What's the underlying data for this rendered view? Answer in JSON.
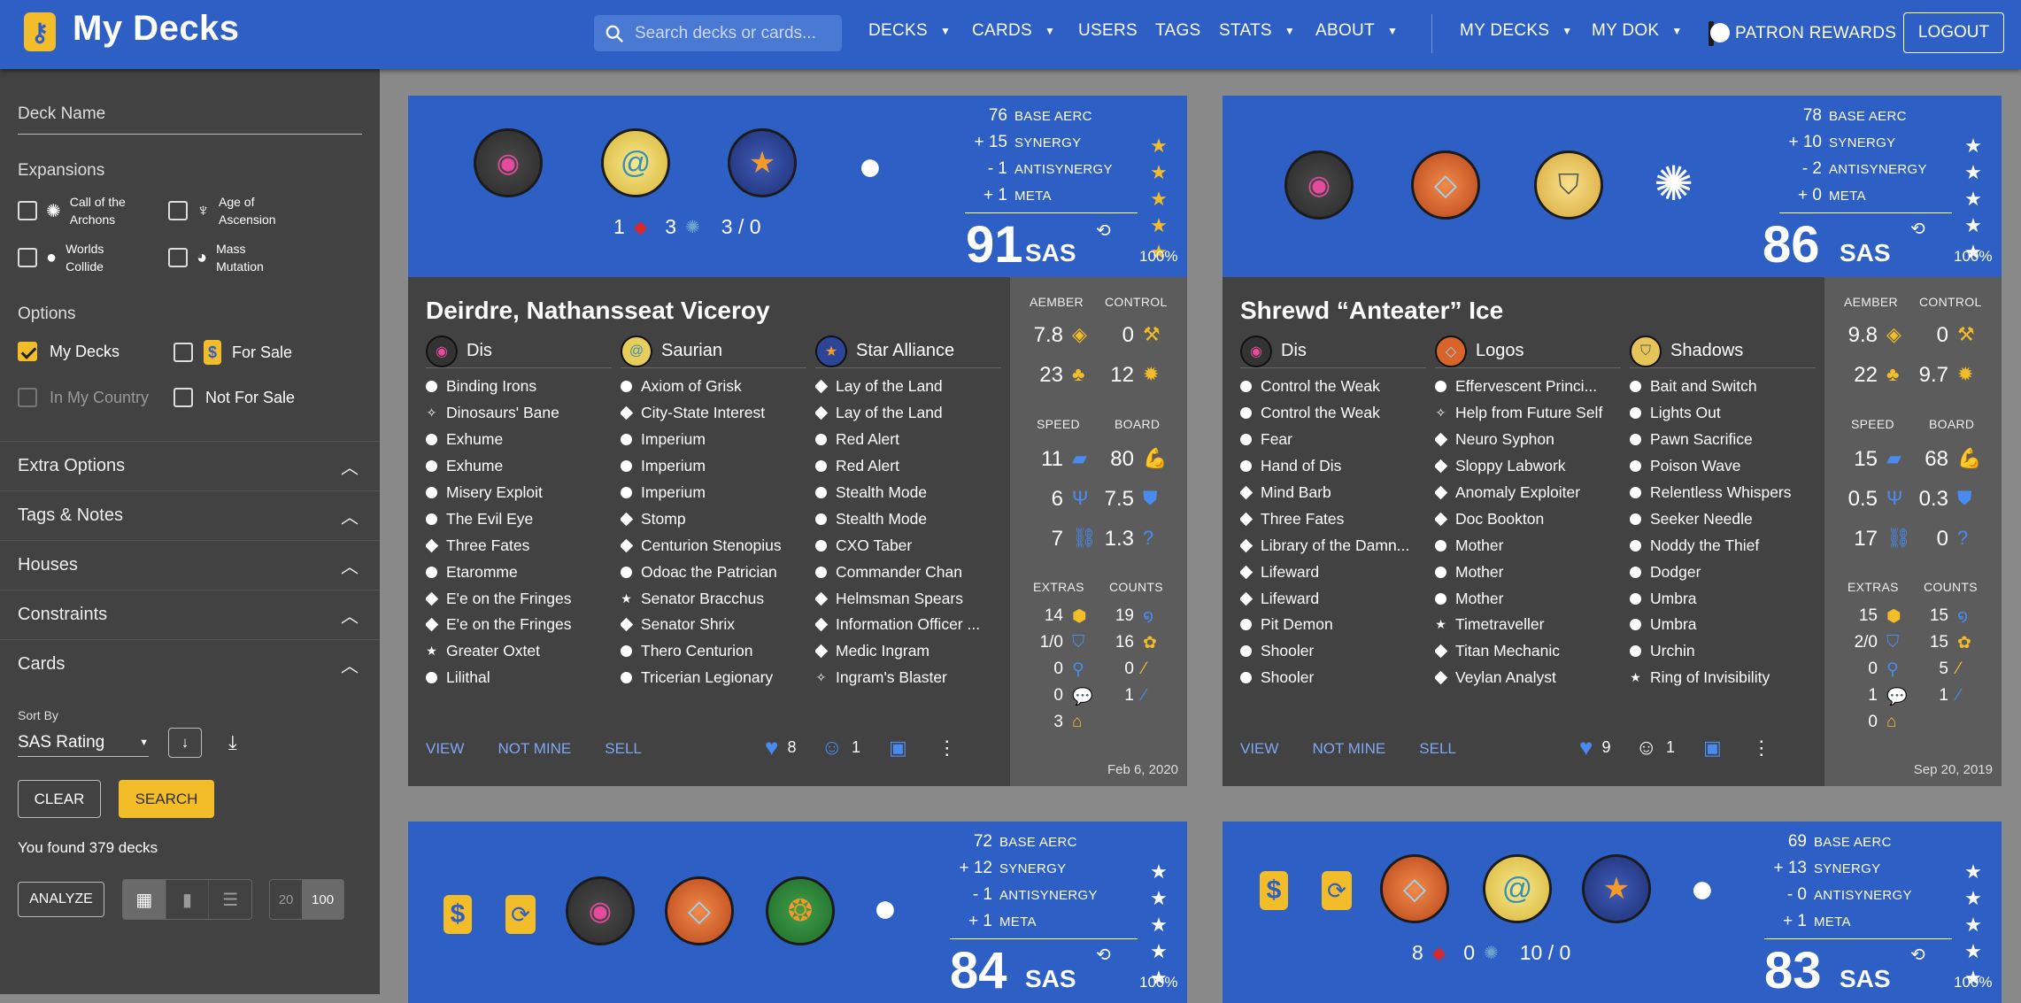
{
  "header": {
    "brand": "My Decks",
    "search_placeholder": "Search decks or cards...",
    "nav": [
      "DECKS",
      "CARDS",
      "USERS",
      "TAGS",
      "STATS",
      "ABOUT"
    ],
    "nav_right": [
      "MY DECKS",
      "MY DOK"
    ],
    "patron": "PATRON REWARDS",
    "logout": "LOGOUT"
  },
  "sidebar": {
    "deck_name_placeholder": "Deck Name",
    "expansions_title": "Expansions",
    "expansions": [
      "Call of the Archons",
      "Age of Ascension",
      "Worlds Collide",
      "Mass Mutation"
    ],
    "options_title": "Options",
    "options": {
      "my_decks": "My Decks",
      "for_sale": "For Sale",
      "in_my_country": "In My Country",
      "not_for_sale": "Not For Sale"
    },
    "sections": [
      "Extra Options",
      "Tags & Notes",
      "Houses",
      "Constraints",
      "Cards"
    ],
    "sort_by_label": "Sort By",
    "sort_value": "SAS Rating",
    "clear": "CLEAR",
    "search": "SEARCH",
    "found": "You found 379 decks",
    "analyze": "ANALYZE",
    "page_sizes": [
      "20",
      "100"
    ]
  },
  "labels": {
    "base_aerc": "BASE AERC",
    "synergy": "SYNERGY",
    "antisynergy": "ANTISYNERGY",
    "meta": "META",
    "sas": "SAS",
    "aember": "AEMBER",
    "control": "CONTROL",
    "speed": "SPEED",
    "board": "BOARD",
    "extras": "EXTRAS",
    "counts": "COUNTS",
    "view": "VIEW",
    "not_mine": "NOT MINE",
    "sell": "SELL"
  },
  "decks": [
    {
      "base": "76",
      "syn": "+ 15",
      "anti": "- 1",
      "meta": "+ 1",
      "sas": "91",
      "pct": "100%",
      "counts_line": {
        "a": "1",
        "b": "3",
        "c": "3 / 0"
      },
      "name": "Deirdre, Nathansseat Viceroy",
      "houses": [
        {
          "name": "Dis",
          "cards": [
            "Binding Irons",
            "Dinosaurs' Bane",
            "Exhume",
            "Exhume",
            "Misery Exploit",
            "The Evil Eye",
            "Three Fates",
            "Etaromme",
            "E'e on the Fringes",
            "E'e on the Fringes",
            "Greater Oxtet",
            "Lilithal"
          ]
        },
        {
          "name": "Saurian",
          "cards": [
            "Axiom of Grisk",
            "City-State Interest",
            "Imperium",
            "Imperium",
            "Imperium",
            "Stomp",
            "Centurion Stenopius",
            "Odoac the Patrician",
            "Senator Bracchus",
            "Senator Shrix",
            "Thero Centurion",
            "Tricerian Legionary"
          ]
        },
        {
          "name": "Star Alliance",
          "cards": [
            "Lay of the Land",
            "Lay of the Land",
            "Red Alert",
            "Red Alert",
            "Stealth Mode",
            "Stealth Mode",
            "CXO Taber",
            "Commander Chan",
            "Helmsman Spears",
            "Information Officer ...",
            "Medic Ingram",
            "Ingram's Blaster"
          ]
        }
      ],
      "stats": {
        "aember1": "7.8",
        "aember2": "23",
        "control1": "0",
        "control2": "12",
        "speed1": "11",
        "speed2": "6",
        "speed3": "7",
        "board1": "80",
        "board2": "7.5",
        "board3": "1.3",
        "extras": [
          "14",
          "1/0",
          "0",
          "0",
          "3"
        ],
        "counts": [
          "19",
          "16",
          "0",
          "1"
        ]
      },
      "likes": "8",
      "funny": "1",
      "date": "Feb 6, 2020"
    },
    {
      "base": "78",
      "syn": "+ 10",
      "anti": "- 2",
      "meta": "+ 0",
      "sas": "86",
      "pct": "100%",
      "name": "Shrewd “Anteater” Ice",
      "houses": [
        {
          "name": "Dis",
          "cards": [
            "Control the Weak",
            "Control the Weak",
            "Fear",
            "Hand of Dis",
            "Mind Barb",
            "Three Fates",
            "Library of the Damn...",
            "Lifeward",
            "Lifeward",
            "Pit Demon",
            "Shooler",
            "Shooler"
          ]
        },
        {
          "name": "Logos",
          "cards": [
            "Effervescent Princi...",
            "Help from Future Self",
            "Neuro Syphon",
            "Sloppy Labwork",
            "Anomaly Exploiter",
            "Doc Bookton",
            "Mother",
            "Mother",
            "Mother",
            "Timetraveller",
            "Titan Mechanic",
            "Veylan Analyst"
          ]
        },
        {
          "name": "Shadows",
          "cards": [
            "Bait and Switch",
            "Lights Out",
            "Pawn Sacrifice",
            "Poison Wave",
            "Relentless Whispers",
            "Seeker Needle",
            "Noddy the Thief",
            "Dodger",
            "Umbra",
            "Umbra",
            "Urchin",
            "Ring of Invisibility"
          ]
        }
      ],
      "stats": {
        "aember1": "9.8",
        "aember2": "22",
        "control1": "0",
        "control2": "9.7",
        "speed1": "15",
        "speed2": "0.5",
        "speed3": "17",
        "board1": "68",
        "board2": "0.3",
        "board3": "0",
        "extras": [
          "15",
          "2/0",
          "0",
          "1",
          "0"
        ],
        "counts": [
          "15",
          "15",
          "5",
          "1"
        ]
      },
      "likes": "9",
      "funny": "1",
      "date": "Sep 20, 2019"
    },
    {
      "base": "72",
      "syn": "+ 12",
      "anti": "- 1",
      "meta": "+ 1",
      "sas": "84",
      "pct": "100%"
    },
    {
      "base": "69",
      "syn": "+ 13",
      "anti": "- 0",
      "meta": "+ 1",
      "sas": "83",
      "pct": "100%",
      "counts_line": {
        "a": "8",
        "b": "0",
        "c": "10 / 0"
      }
    }
  ],
  "colors": {
    "primary": "#2d5fc4",
    "accent": "#f3bd2a",
    "panel": "#424242",
    "stats": "#5c5c5c",
    "link": "#7fa7f0"
  }
}
